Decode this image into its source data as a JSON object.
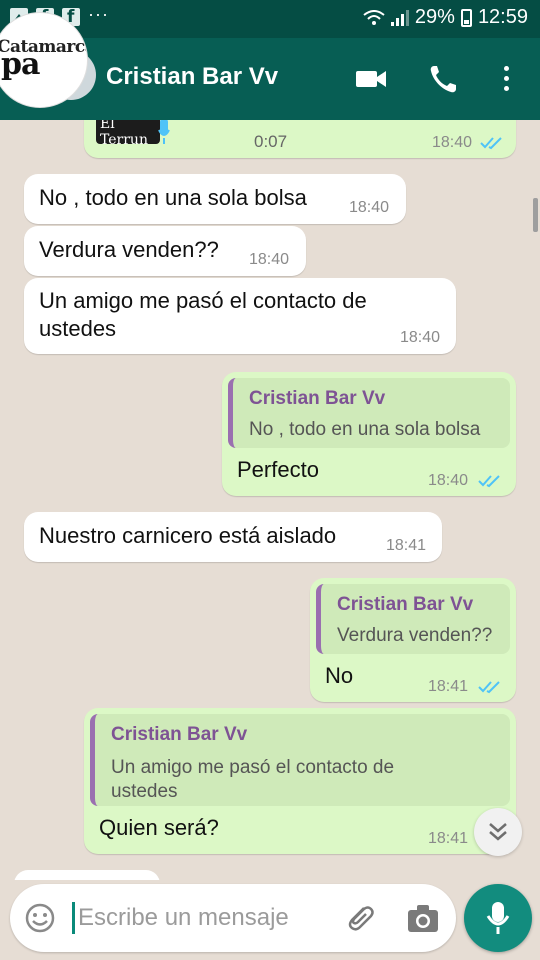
{
  "status_bar": {
    "notif_dots": "···",
    "battery": "29%",
    "time": "12:59"
  },
  "header": {
    "contact_name": "Cristian Bar Vv",
    "avatar_logo_line1": "Catamarca",
    "avatar_logo_line2": "pa"
  },
  "audio_message": {
    "thumb_text": "El Terrun",
    "duration": "0:07",
    "time": "18:40"
  },
  "messages": [
    {
      "direction": "in",
      "text": "No , todo en una sola bolsa",
      "time": "18:40"
    },
    {
      "direction": "in",
      "text": "Verdura venden??",
      "time": "18:40"
    },
    {
      "direction": "in",
      "text_line1": "Un amigo me pasó el contacto de",
      "text_line2": "ustedes",
      "time": "18:40"
    },
    {
      "direction": "out",
      "quote_author": "Cristian Bar Vv",
      "quote_text": "No , todo en una sola bolsa",
      "text": "Perfecto",
      "time": "18:40"
    },
    {
      "direction": "in",
      "text": "Nuestro carnicero está aislado",
      "time": "18:41"
    },
    {
      "direction": "out",
      "quote_author": "Cristian Bar Vv",
      "quote_text": "Verdura venden??",
      "text": "No",
      "time": "18:41"
    },
    {
      "direction": "out",
      "quote_author": "Cristian Bar Vv",
      "quote_text_line1": "Un amigo me pasó el contacto de",
      "quote_text_line2": "ustedes",
      "text": "Quien será?",
      "time": "18:41"
    }
  ],
  "input": {
    "placeholder": "Escribe un mensaje"
  },
  "colors": {
    "header": "#075e54",
    "status_bar": "#054d44",
    "outgoing_bubble": "#dcf8c6",
    "incoming_bubble": "#ffffff",
    "read_ticks": "#4fc3f7",
    "fab": "#128c7e"
  },
  "icons": [
    "image-icon",
    "facebook-icon",
    "wifi-icon",
    "signal-icon",
    "battery-icon",
    "back-arrow-icon",
    "video-call-icon",
    "phone-icon",
    "menu-icon",
    "read-ticks-icon",
    "scroll-down-icon",
    "emoji-icon",
    "attach-icon",
    "camera-icon",
    "mic-icon"
  ]
}
